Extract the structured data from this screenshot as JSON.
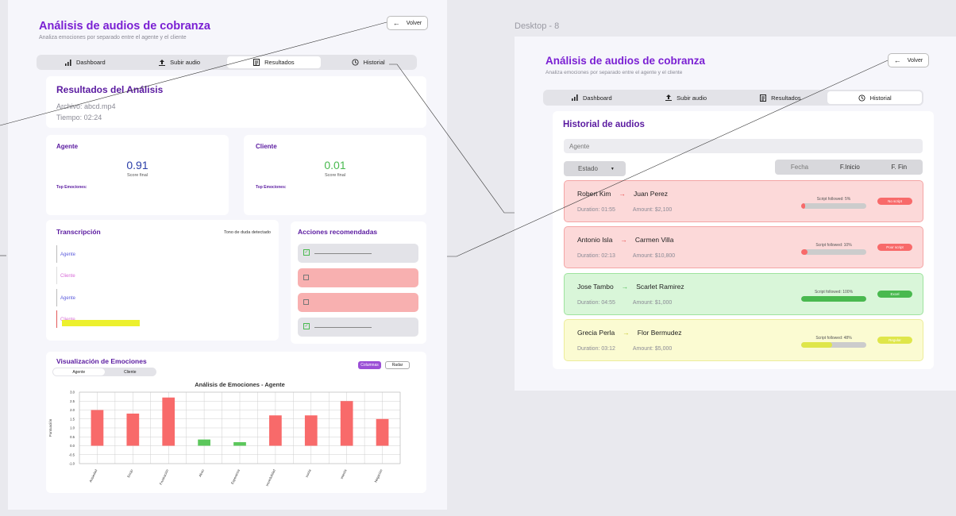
{
  "canvas": {
    "frame2_label": "Desktop - 8"
  },
  "left": {
    "title": "Análisis de audios de cobranza",
    "subtitle": "Analiza emociones por separado entre el agente y el cliente",
    "back_label": "Volver",
    "tabs": [
      {
        "label": "Dashboard",
        "icon": "bar-chart-icon",
        "active": false
      },
      {
        "label": "Subir audio",
        "icon": "upload-icon",
        "active": false
      },
      {
        "label": "Resultados",
        "icon": "document-icon",
        "active": true
      },
      {
        "label": "Historial",
        "icon": "history-icon",
        "active": false
      }
    ],
    "results": {
      "title": "Resultados del Análisis",
      "file": "Archivo: abcd.mp4",
      "time": "Tiempo: 02:24"
    },
    "agent": {
      "label": "Agente",
      "score": "0.91",
      "score_caption": "Score final",
      "top_emotions": "Top Emociones:"
    },
    "client": {
      "label": "Cliente",
      "score": "0.01",
      "score_caption": "Score final",
      "top_emotions": "Top Emociones:"
    },
    "transcription": {
      "title": "Transcripción",
      "note": "Tono de duda detectado",
      "entries": [
        "Agente",
        "Cliente",
        "Agente",
        "Cliente"
      ]
    },
    "actions": {
      "title": "Acciones recomendadas",
      "items": [
        {
          "checked": true,
          "color": "#e3e3e8"
        },
        {
          "checked": false,
          "color": "#f8b0b0"
        },
        {
          "checked": false,
          "color": "#f8b0b0"
        },
        {
          "checked": true,
          "color": "#e3e3e8"
        }
      ]
    },
    "emotions": {
      "title": "Visualización de Emociones",
      "toggle": [
        "Agente",
        "Cliente"
      ],
      "view_buttons": [
        "Columnas",
        "Radar"
      ]
    }
  },
  "right": {
    "title": "Análisis de audios de cobranza",
    "subtitle": "Analiza emociones por separado entre el agente y el cliente",
    "back_label": "Volver",
    "tabs": [
      {
        "label": "Dashboard",
        "icon": "bar-chart-icon",
        "active": false
      },
      {
        "label": "Subir audio",
        "icon": "upload-icon",
        "active": false
      },
      {
        "label": "Resultados",
        "icon": "document-icon",
        "active": false
      },
      {
        "label": "Historial",
        "icon": "history-icon",
        "active": true
      }
    ],
    "history": {
      "title": "Historial de audios",
      "agent_placeholder": "Agente",
      "estado_label": "Estado",
      "filters": [
        "Fecha",
        "F.Inicio",
        "F. Fin"
      ],
      "items": [
        {
          "agent": "Robert Kim",
          "client": "Juan Perez",
          "duration": "Duration: 01:55",
          "amount": "Amount: $2,100",
          "script": "Script followed: 5%",
          "progress": 0.05,
          "badge": "No script",
          "bg": "#fcd9d9",
          "border": "#f4a5a5",
          "accent": "#f86a6a",
          "arrow": "#e84d4d"
        },
        {
          "agent": "Antonio Isla",
          "client": "Carmen Villa",
          "duration": "Duration: 02:13",
          "amount": "Amount: $10,800",
          "script": "Script followed: 10%",
          "progress": 0.1,
          "badge": "Poor script",
          "bg": "#fcd9d9",
          "border": "#f4a5a5",
          "accent": "#f86a6a",
          "arrow": "#e84d4d"
        },
        {
          "agent": "Jose Tambo",
          "client": "Scarlet Ramirez",
          "duration": "Duration: 04:55",
          "amount": "Amount: $1,000",
          "script": "Script followed: 100%",
          "progress": 1.0,
          "badge": "Excel",
          "bg": "#d9f6d9",
          "border": "#9ee39e",
          "accent": "#49b94f",
          "arrow": "#49b94f"
        },
        {
          "agent": "Grecia Perla",
          "client": "Flor Bermudez",
          "duration": "Duration: 03:12",
          "amount": "Amount: $5,000",
          "script": "Script followed: 48%",
          "progress": 0.48,
          "badge": "Regular",
          "bg": "#fbfbd2",
          "border": "#ecec9a",
          "accent": "#dfe64a",
          "arrow": "#c5c528"
        }
      ]
    }
  },
  "chart_data": {
    "type": "bar",
    "title": "Análisis de Emociones - Agente",
    "ylabel": "Puntuación",
    "xlabel": "",
    "ylim": [
      -1.0,
      3.0
    ],
    "yticks": [
      "3.0",
      "2.5",
      "2.0",
      "1.5",
      "1.0",
      "0.5",
      "0.0",
      "-0.5",
      "-1.0"
    ],
    "categories": [
      "Ansiedad",
      "Enojo",
      "Frustración",
      "Alivio",
      "Esperanza",
      "Incredulidad",
      "Ironía",
      "Interés",
      "Negación"
    ],
    "values": [
      2.0,
      1.8,
      2.7,
      0.35,
      0.2,
      1.7,
      1.7,
      2.5,
      1.5
    ],
    "colors": [
      "#f86a6a",
      "#f86a6a",
      "#f86a6a",
      "#5cc75c",
      "#5cc75c",
      "#f86a6a",
      "#f86a6a",
      "#f86a6a",
      "#f86a6a"
    ],
    "grid": true
  }
}
